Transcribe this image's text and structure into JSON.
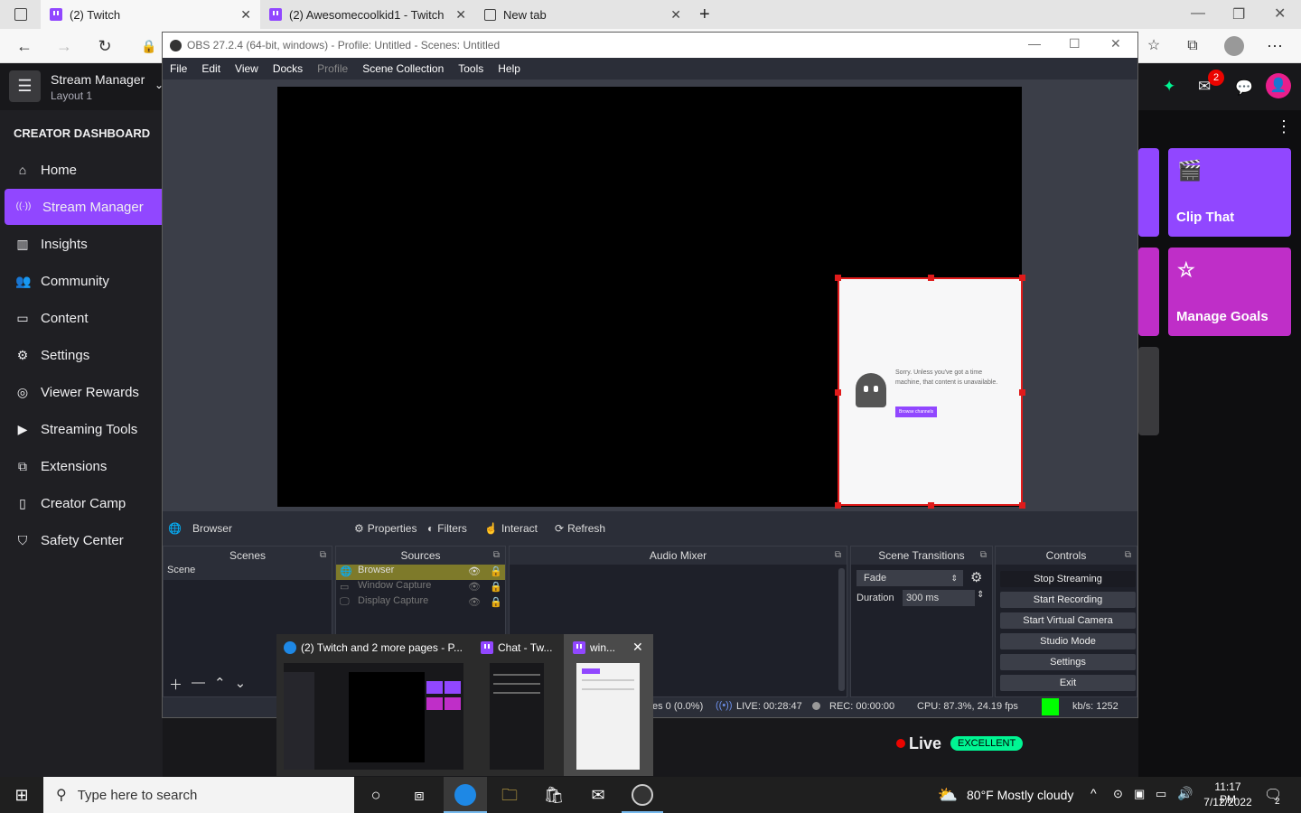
{
  "browser": {
    "tabs": [
      {
        "title": "(2) Twitch",
        "active": true
      },
      {
        "title": "(2) Awesomecoolkid1 - Twitch",
        "active": false
      },
      {
        "title": "New tab",
        "active": false
      }
    ],
    "new_tab": "+"
  },
  "twitch": {
    "manager_title": "Stream Manager",
    "manager_layout": "Layout 1",
    "notification_count": "2",
    "sidebar_header": "CREATOR DASHBOARD",
    "sidebar_items": [
      {
        "label": "Home",
        "icon": "⌂"
      },
      {
        "label": "Stream Manager",
        "icon": "((·))"
      },
      {
        "label": "Insights",
        "icon": "▥"
      },
      {
        "label": "Community",
        "icon": "👥"
      },
      {
        "label": "Content",
        "icon": "▭"
      },
      {
        "label": "Settings",
        "icon": "⚙"
      },
      {
        "label": "Viewer Rewards",
        "icon": "◎"
      },
      {
        "label": "Streaming Tools",
        "icon": "▶"
      },
      {
        "label": "Extensions",
        "icon": "⧉"
      },
      {
        "label": "Creator Camp",
        "icon": "▯"
      },
      {
        "label": "Safety Center",
        "icon": "⛉"
      }
    ],
    "tiles": [
      {
        "label": "Clip That"
      },
      {
        "label": "Manage Goals"
      }
    ],
    "live_label": "Live",
    "health_label": "EXCELLENT",
    "colors": {
      "accent": "#9147ff",
      "tile2": "#bf2ec8",
      "live": "#eb0400",
      "excellent": "#00f593"
    }
  },
  "obs": {
    "title": "OBS 27.2.4 (64-bit, windows) - Profile: Untitled - Scenes: Untitled",
    "menu": [
      "File",
      "Edit",
      "View",
      "Docks",
      "Profile",
      "Scene Collection",
      "Tools",
      "Help"
    ],
    "source_preview": {
      "message": "Sorry. Unless you've got a time machine, that content is unavailable.",
      "button": "Browse channels"
    },
    "source_toolbar": {
      "selected": "Browser",
      "properties": "Properties",
      "filters": "Filters",
      "interact": "Interact",
      "refresh": "Refresh"
    },
    "docks": {
      "scenes": "Scenes",
      "sources": "Sources",
      "audio_mixer": "Audio Mixer",
      "scene_transitions": "Scene Transitions",
      "controls": "Controls"
    },
    "scenes": [
      "Scene"
    ],
    "sources": [
      "Browser",
      "Window Capture",
      "Display Capture"
    ],
    "transition": {
      "type": "Fade",
      "duration_label": "Duration",
      "duration": "300 ms"
    },
    "controls": [
      "Stop Streaming",
      "Start Recording",
      "Start Virtual Camera",
      "Studio Mode",
      "Settings",
      "Exit"
    ],
    "status": {
      "dropped": "es 0 (0.0%)",
      "live": "LIVE: 00:28:47",
      "rec": "REC: 00:00:00",
      "cpu": "CPU: 87.3%, 24.19 fps",
      "kbs": "kb/s: 1252"
    }
  },
  "thumbnails": [
    {
      "title": "(2) Twitch and 2 more pages - P..."
    },
    {
      "title": "Chat - Tw..."
    },
    {
      "title": "win..."
    }
  ],
  "taskbar": {
    "search_placeholder": "Type here to search",
    "weather": "80°F  Mostly cloudy",
    "time": "11:17 PM",
    "date": "7/12/2022",
    "notif_count": "2"
  }
}
